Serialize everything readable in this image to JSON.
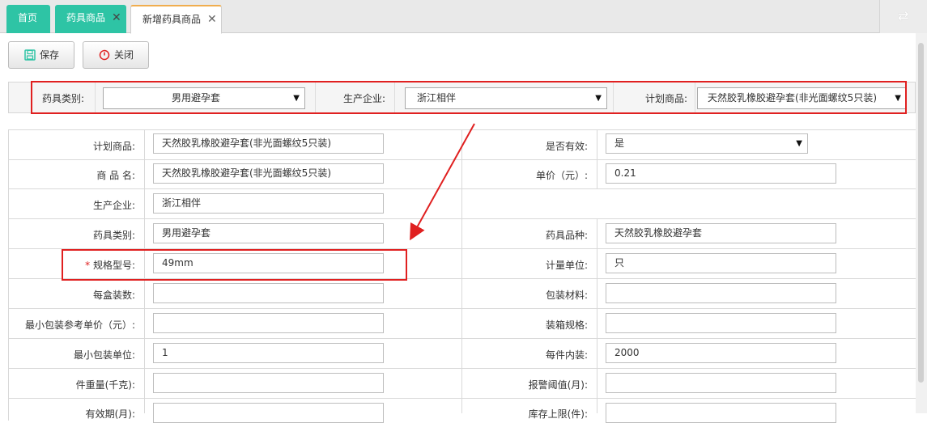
{
  "tabs": [
    {
      "label": "首页"
    },
    {
      "label": "药具商品",
      "close": "✕"
    },
    {
      "label": "新增药具商品",
      "close": "✕"
    }
  ],
  "toolbar": {
    "save_label": "保存",
    "close_label": "关闭"
  },
  "filter": {
    "category_label": "药具类别:",
    "category_value": "男用避孕套",
    "manufacturer_label": "生产企业:",
    "manufacturer_value": "浙江相伴",
    "plan_label": "计划商品:",
    "plan_value": "天然胶乳橡胶避孕套(非光面螺纹5只装)"
  },
  "form": {
    "plan_label": "计划商品:",
    "plan_value": "天然胶乳橡胶避孕套(非光面螺纹5只装)",
    "valid_label": "是否有效:",
    "valid_value": "是",
    "name_label": "商 品 名:",
    "name_value": "天然胶乳橡胶避孕套(非光面螺纹5只装)",
    "price_label": "单价（元）:",
    "price_value": "0.21",
    "manufacturer_label": "生产企业:",
    "manufacturer_value": "浙江相伴",
    "category_label": "药具类别:",
    "category_value": "男用避孕套",
    "variety_label": "药具品种:",
    "variety_value": "天然胶乳橡胶避孕套",
    "required_mark": "*",
    "spec_label": "规格型号:",
    "spec_value": "49mm",
    "unit_label": "计量单位:",
    "unit_value": "只",
    "box_qty_label": "每盒装数:",
    "box_qty_value": "",
    "pack_material_label": "包装材料:",
    "pack_material_value": "",
    "min_pack_price_label": "最小包装参考单价（元）:",
    "min_pack_price_value": "",
    "carton_spec_label": "装箱规格:",
    "carton_spec_value": "",
    "min_pack_unit_label": "最小包装单位:",
    "min_pack_unit_value": "1",
    "per_piece_label": "每件内装:",
    "per_piece_value": "2000",
    "weight_label": "件重量(千克):",
    "weight_value": "",
    "alert_label": "报警阈值(月):",
    "alert_value": "",
    "validity_label": "有效期(月):",
    "validity_value": "",
    "stock_limit_label": "库存上限(件):",
    "stock_limit_value": ""
  },
  "colors": {
    "tab_green": "#2ec4a5",
    "tab_active_top": "#f0ad4e",
    "annotation_red": "#e02020"
  }
}
